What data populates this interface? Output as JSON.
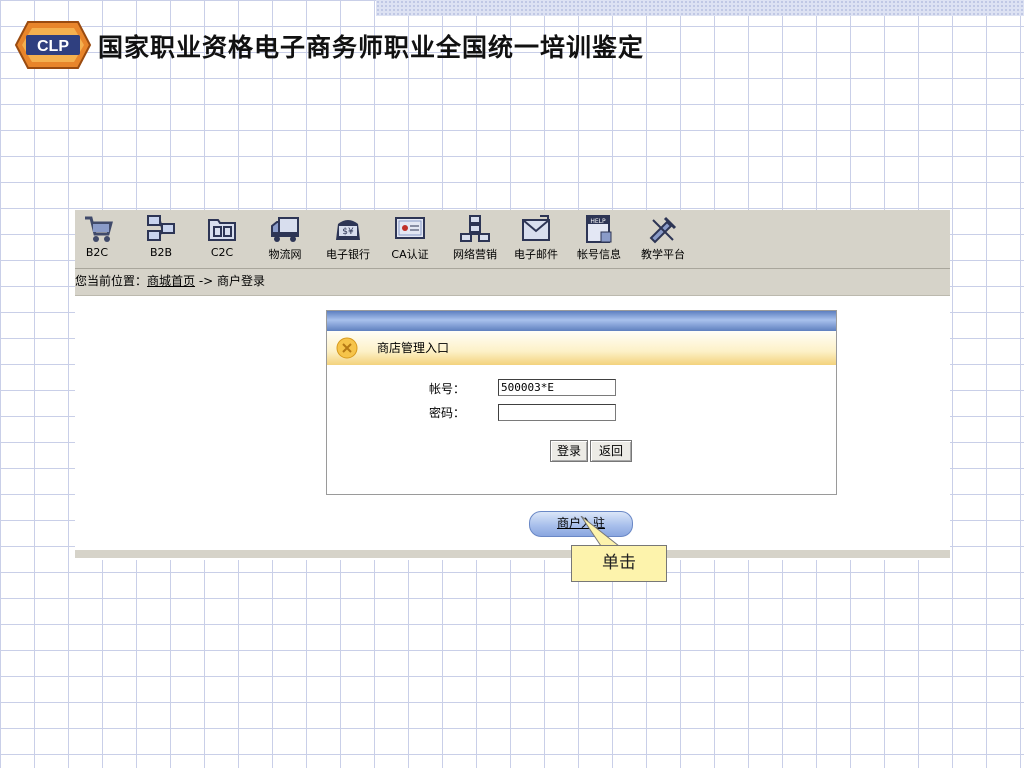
{
  "slide": {
    "logo_text": "CLP",
    "title": "国家职业资格电子商务师职业全国统一培训鉴定"
  },
  "toolbar": {
    "items": [
      {
        "label": "B2C",
        "icon": "shopping-cart-icon"
      },
      {
        "label": "B2B",
        "icon": "network-nodes-icon"
      },
      {
        "label": "C2C",
        "icon": "folder-icon"
      },
      {
        "label": "物流网",
        "icon": "truck-icon"
      },
      {
        "label": "电子银行",
        "icon": "money-bag-icon"
      },
      {
        "label": "CA认证",
        "icon": "certificate-icon"
      },
      {
        "label": "网络营销",
        "icon": "org-chart-icon"
      },
      {
        "label": "电子邮件",
        "icon": "mail-icon"
      },
      {
        "label": "帐号信息",
        "icon": "help-book-icon"
      },
      {
        "label": "教学平台",
        "icon": "tools-icon"
      }
    ]
  },
  "breadcrumb": {
    "prefix": "您当前位置：",
    "home_link": "商城首页",
    "separator": " -> ",
    "current": "商户登录"
  },
  "login_panel": {
    "title": "商店管理入口",
    "account_label": "帐号：",
    "account_value": "500003*E",
    "password_label": "密码：",
    "password_value": "",
    "login_button": "登录",
    "back_button": "返回"
  },
  "join_button": "商户入驻",
  "callout": "单击",
  "colors": {
    "toolbar_bg": "#d6d3c9",
    "panel_header": "#f3d27d",
    "callout_bg": "#fdf3ac",
    "join_button": "#a9c0ec"
  }
}
